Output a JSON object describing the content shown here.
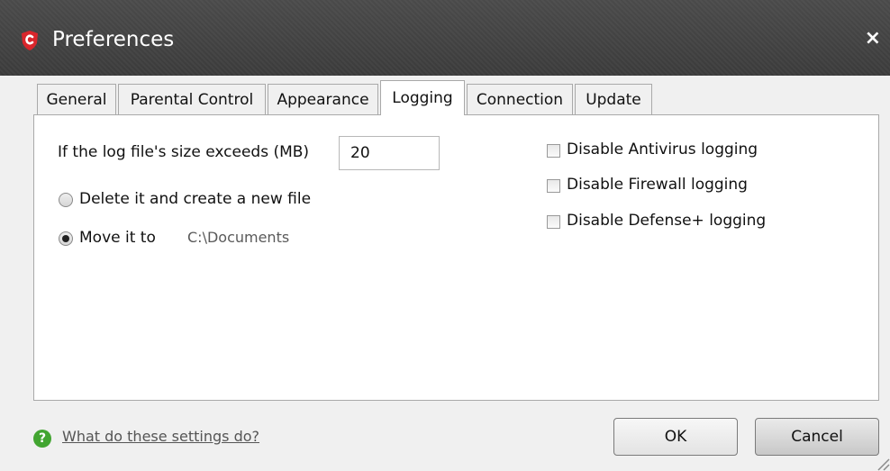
{
  "window": {
    "title": "Preferences",
    "close_glyph": "×"
  },
  "tabs": [
    {
      "label": "General",
      "active": false
    },
    {
      "label": "Parental Control",
      "active": false
    },
    {
      "label": "Appearance",
      "active": false
    },
    {
      "label": "Logging",
      "active": true
    },
    {
      "label": "Connection",
      "active": false
    },
    {
      "label": "Update",
      "active": false
    }
  ],
  "logging": {
    "size_label": "If the log file's size exceeds (MB)",
    "size_value": "20",
    "option_delete": {
      "label": "Delete it and create a new file",
      "selected": false
    },
    "option_move": {
      "label": "Move it to",
      "selected": true
    },
    "move_path": "C:\\Documents",
    "checkboxes": [
      {
        "label": "Disable Antivirus logging",
        "checked": false
      },
      {
        "label": "Disable Firewall logging",
        "checked": false
      },
      {
        "label": "Disable Defense+ logging",
        "checked": false
      }
    ]
  },
  "footer": {
    "help_link": "What do these settings do?",
    "help_icon": "?",
    "ok_label": "OK",
    "cancel_label": "Cancel"
  },
  "icons": {
    "app": "comodo-shield-icon",
    "help": "help-icon",
    "close": "close-icon",
    "resize": "resize-grip-icon"
  },
  "colors": {
    "titlebar": "#404040",
    "help_green": "#42a531",
    "logo_red": "#d9262c"
  }
}
